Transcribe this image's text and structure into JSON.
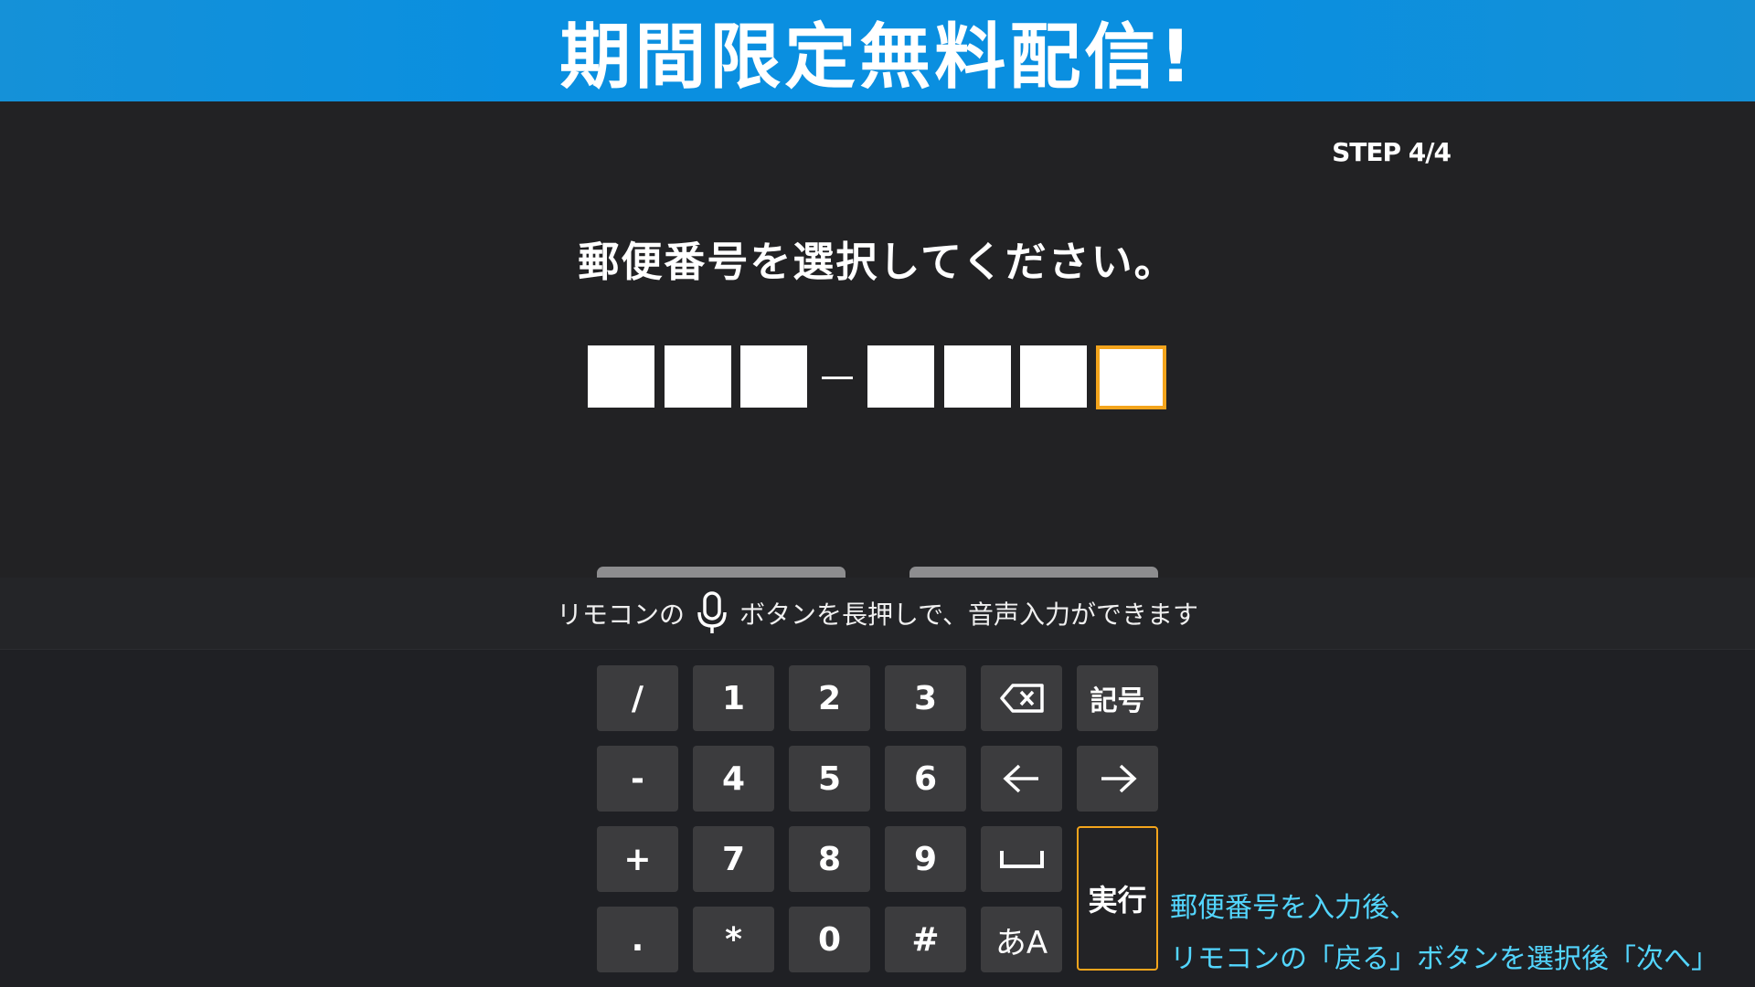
{
  "banner": {
    "title": "期間限定無料配信!"
  },
  "step": {
    "label": "STEP 4/4"
  },
  "instruction": {
    "text": "郵便番号を選択してください。"
  },
  "postal": {
    "first": [
      "",
      "",
      ""
    ],
    "second": [
      "",
      "",
      "",
      ""
    ]
  },
  "voice": {
    "prefix": "リモコンの",
    "suffix": "ボタンを長押しで、音声入力ができます"
  },
  "keyboard": {
    "rows": [
      [
        "/",
        "1",
        "2",
        "3",
        "backspace",
        "記号"
      ],
      [
        "-",
        "4",
        "5",
        "6",
        "left",
        "right"
      ],
      [
        "+",
        "7",
        "8",
        "9",
        "space"
      ],
      [
        ".",
        "*",
        "0",
        "#",
        "あA"
      ]
    ],
    "enter_label": "実行"
  },
  "hint": {
    "line1": "郵便番号を入力後、",
    "line2": "リモコンの「戻る」ボタンを選択後「次へ」"
  },
  "colors": {
    "banner": "#0a8fe0",
    "focus": "#f3a41c",
    "hint": "#53d6ff",
    "background": "#222224"
  }
}
